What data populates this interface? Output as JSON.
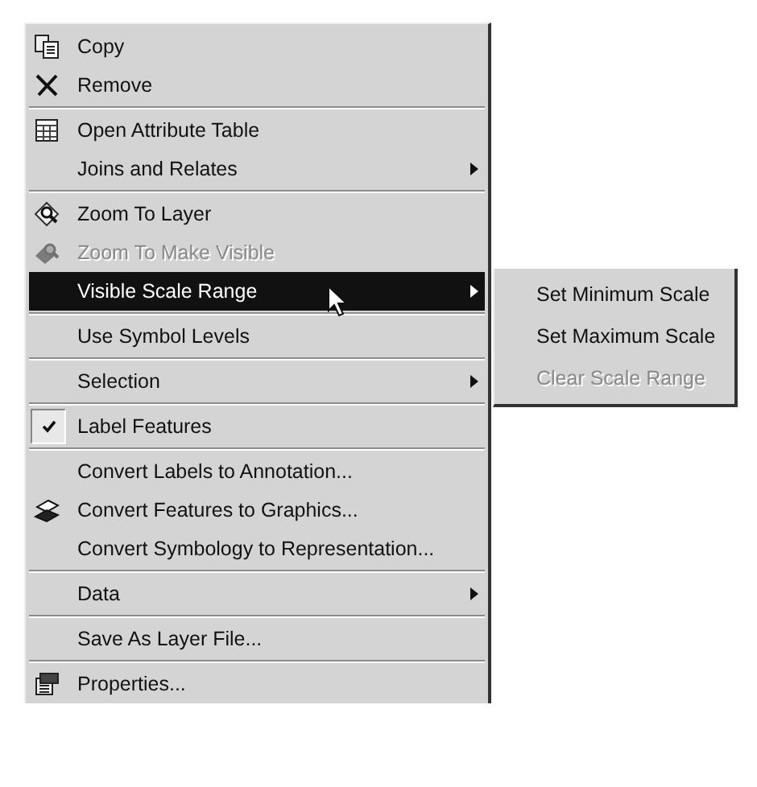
{
  "menu": {
    "items": [
      {
        "kind": "item",
        "label": "Copy",
        "submenu": false,
        "disabled": false,
        "checked": false,
        "selected": false
      },
      {
        "kind": "item",
        "label": "Remove",
        "submenu": false,
        "disabled": false,
        "checked": false,
        "selected": false
      },
      {
        "kind": "separator"
      },
      {
        "kind": "item",
        "label": "Open Attribute Table",
        "submenu": false,
        "disabled": false,
        "checked": false,
        "selected": false
      },
      {
        "kind": "item",
        "label": "Joins and Relates",
        "submenu": true,
        "disabled": false,
        "checked": false,
        "selected": false
      },
      {
        "kind": "separator"
      },
      {
        "kind": "item",
        "label": "Zoom To Layer",
        "submenu": false,
        "disabled": false,
        "checked": false,
        "selected": false
      },
      {
        "kind": "item",
        "label": "Zoom To Make Visible",
        "submenu": false,
        "disabled": true,
        "checked": false,
        "selected": false
      },
      {
        "kind": "item",
        "label": "Visible Scale Range",
        "submenu": true,
        "disabled": false,
        "checked": false,
        "selected": true,
        "children": [
          {
            "label": "Set Minimum Scale",
            "disabled": false
          },
          {
            "label": "Set Maximum Scale",
            "disabled": false
          },
          {
            "label": "Clear Scale Range",
            "disabled": true
          }
        ]
      },
      {
        "kind": "separator"
      },
      {
        "kind": "item",
        "label": "Use Symbol Levels",
        "submenu": false,
        "disabled": false,
        "checked": false,
        "selected": false
      },
      {
        "kind": "separator"
      },
      {
        "kind": "item",
        "label": "Selection",
        "submenu": true,
        "disabled": false,
        "checked": false,
        "selected": false
      },
      {
        "kind": "separator"
      },
      {
        "kind": "item",
        "label": "Label Features",
        "submenu": false,
        "disabled": false,
        "checked": true,
        "selected": false
      },
      {
        "kind": "separator"
      },
      {
        "kind": "item",
        "label": "Convert Labels to Annotation...",
        "submenu": false,
        "disabled": false,
        "checked": false,
        "selected": false
      },
      {
        "kind": "item",
        "label": "Convert Features to Graphics...",
        "submenu": false,
        "disabled": false,
        "checked": false,
        "selected": false
      },
      {
        "kind": "item",
        "label": "Convert Symbology to Representation...",
        "submenu": false,
        "disabled": false,
        "checked": false,
        "selected": false
      },
      {
        "kind": "separator"
      },
      {
        "kind": "item",
        "label": "Data",
        "submenu": true,
        "disabled": false,
        "checked": false,
        "selected": false
      },
      {
        "kind": "separator"
      },
      {
        "kind": "item",
        "label": "Save As Layer File...",
        "submenu": false,
        "disabled": false,
        "checked": false,
        "selected": false
      },
      {
        "kind": "separator"
      },
      {
        "kind": "item",
        "label": "Properties...",
        "submenu": false,
        "disabled": false,
        "checked": false,
        "selected": false
      }
    ]
  }
}
